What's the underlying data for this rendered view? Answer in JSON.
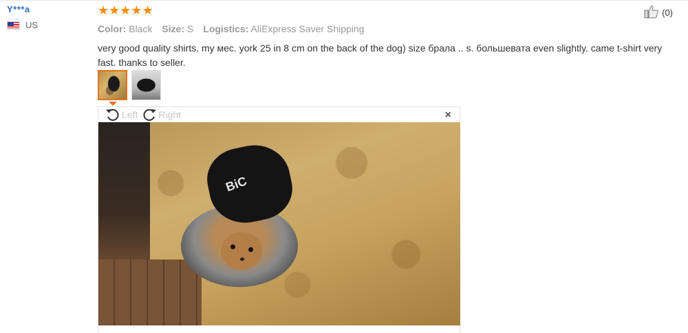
{
  "user": {
    "name": "Y***a",
    "country": "US"
  },
  "review": {
    "rating": 5,
    "stars": [
      "★",
      "★",
      "★",
      "★",
      "★"
    ],
    "color_label": "Color:",
    "color_value": "Black",
    "size_label": "Size:",
    "size_value": "S",
    "logistics_label": "Logistics:",
    "logistics_value": "AliExpress Saver Shipping",
    "text": "very good quality shirts. my мес. york 25 in 8 cm on the back of the dog) size брала .. s. большевата even slightly. came t-shirt very fast. thanks to seller.",
    "helpful_count": "(0)"
  },
  "viewer": {
    "rotate_left_label": "Left",
    "rotate_right_label": "Right",
    "close_glyph": "×",
    "photo_print_text": "BiC"
  },
  "colors": {
    "accent": "#e2731b",
    "star": "#f48b05",
    "user_name": "#2e6bbd"
  },
  "icons": {
    "thumbs_up": "thumbs-up-icon",
    "rotate_left": "rotate-left-icon",
    "rotate_right": "rotate-right-icon",
    "close": "close-icon",
    "flag": "us-flag-icon"
  }
}
